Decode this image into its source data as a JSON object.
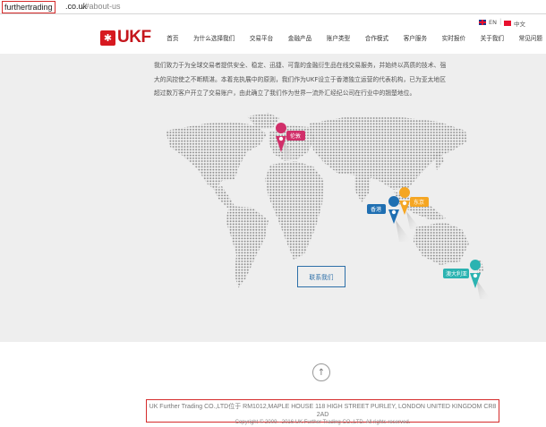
{
  "address_bar": {
    "host": "furthertrading",
    "tld": ".co.uk",
    "path": "/#about-us"
  },
  "language": {
    "en": "EN",
    "separator": "|",
    "zh": "中文"
  },
  "logo": {
    "brand": "UKF"
  },
  "nav": {
    "items": [
      "首页",
      "为什么选择我们",
      "交易平台",
      "金融产品",
      "账户类型",
      "合作模式",
      "客户服务",
      "实时报价",
      "关于我们",
      "常见问题"
    ]
  },
  "intro": {
    "lines": [
      "我们致力于为全球交易者提供安全、稳定、迅捷、可靠的金融衍生品在线交易服务，并始终以高质的技术、强",
      "大的风控使之不断精湛。本着充执展中的原则，我们作为UKF设立于香港独立运营的代表机构，已为亚太地区",
      "超过数万客户开立了交易账户，由此确立了我们作为世界一流外汇经纪公司在行业中的翘楚地位。"
    ]
  },
  "map": {
    "pins": [
      {
        "label": "伦敦",
        "color": "#d12f6a"
      },
      {
        "label": "东京",
        "color": "#f5a623"
      },
      {
        "label": "香港",
        "color": "#1f6fb2"
      },
      {
        "label": "澳大利亚",
        "color": "#2bb3b1"
      }
    ]
  },
  "contact_button": {
    "label": "联系我们"
  },
  "footer": {
    "address": "UK Further Trading CO.,LTD位于 RM1012,MAPLE HOUSE 118 HIGH STREET PURLEY, LONDON UNITED KINGDOM CR8 2AD",
    "copyright": "Copyright © 2009 - 2016 UK Further Trading CO.,LTD. All rights reserved."
  }
}
